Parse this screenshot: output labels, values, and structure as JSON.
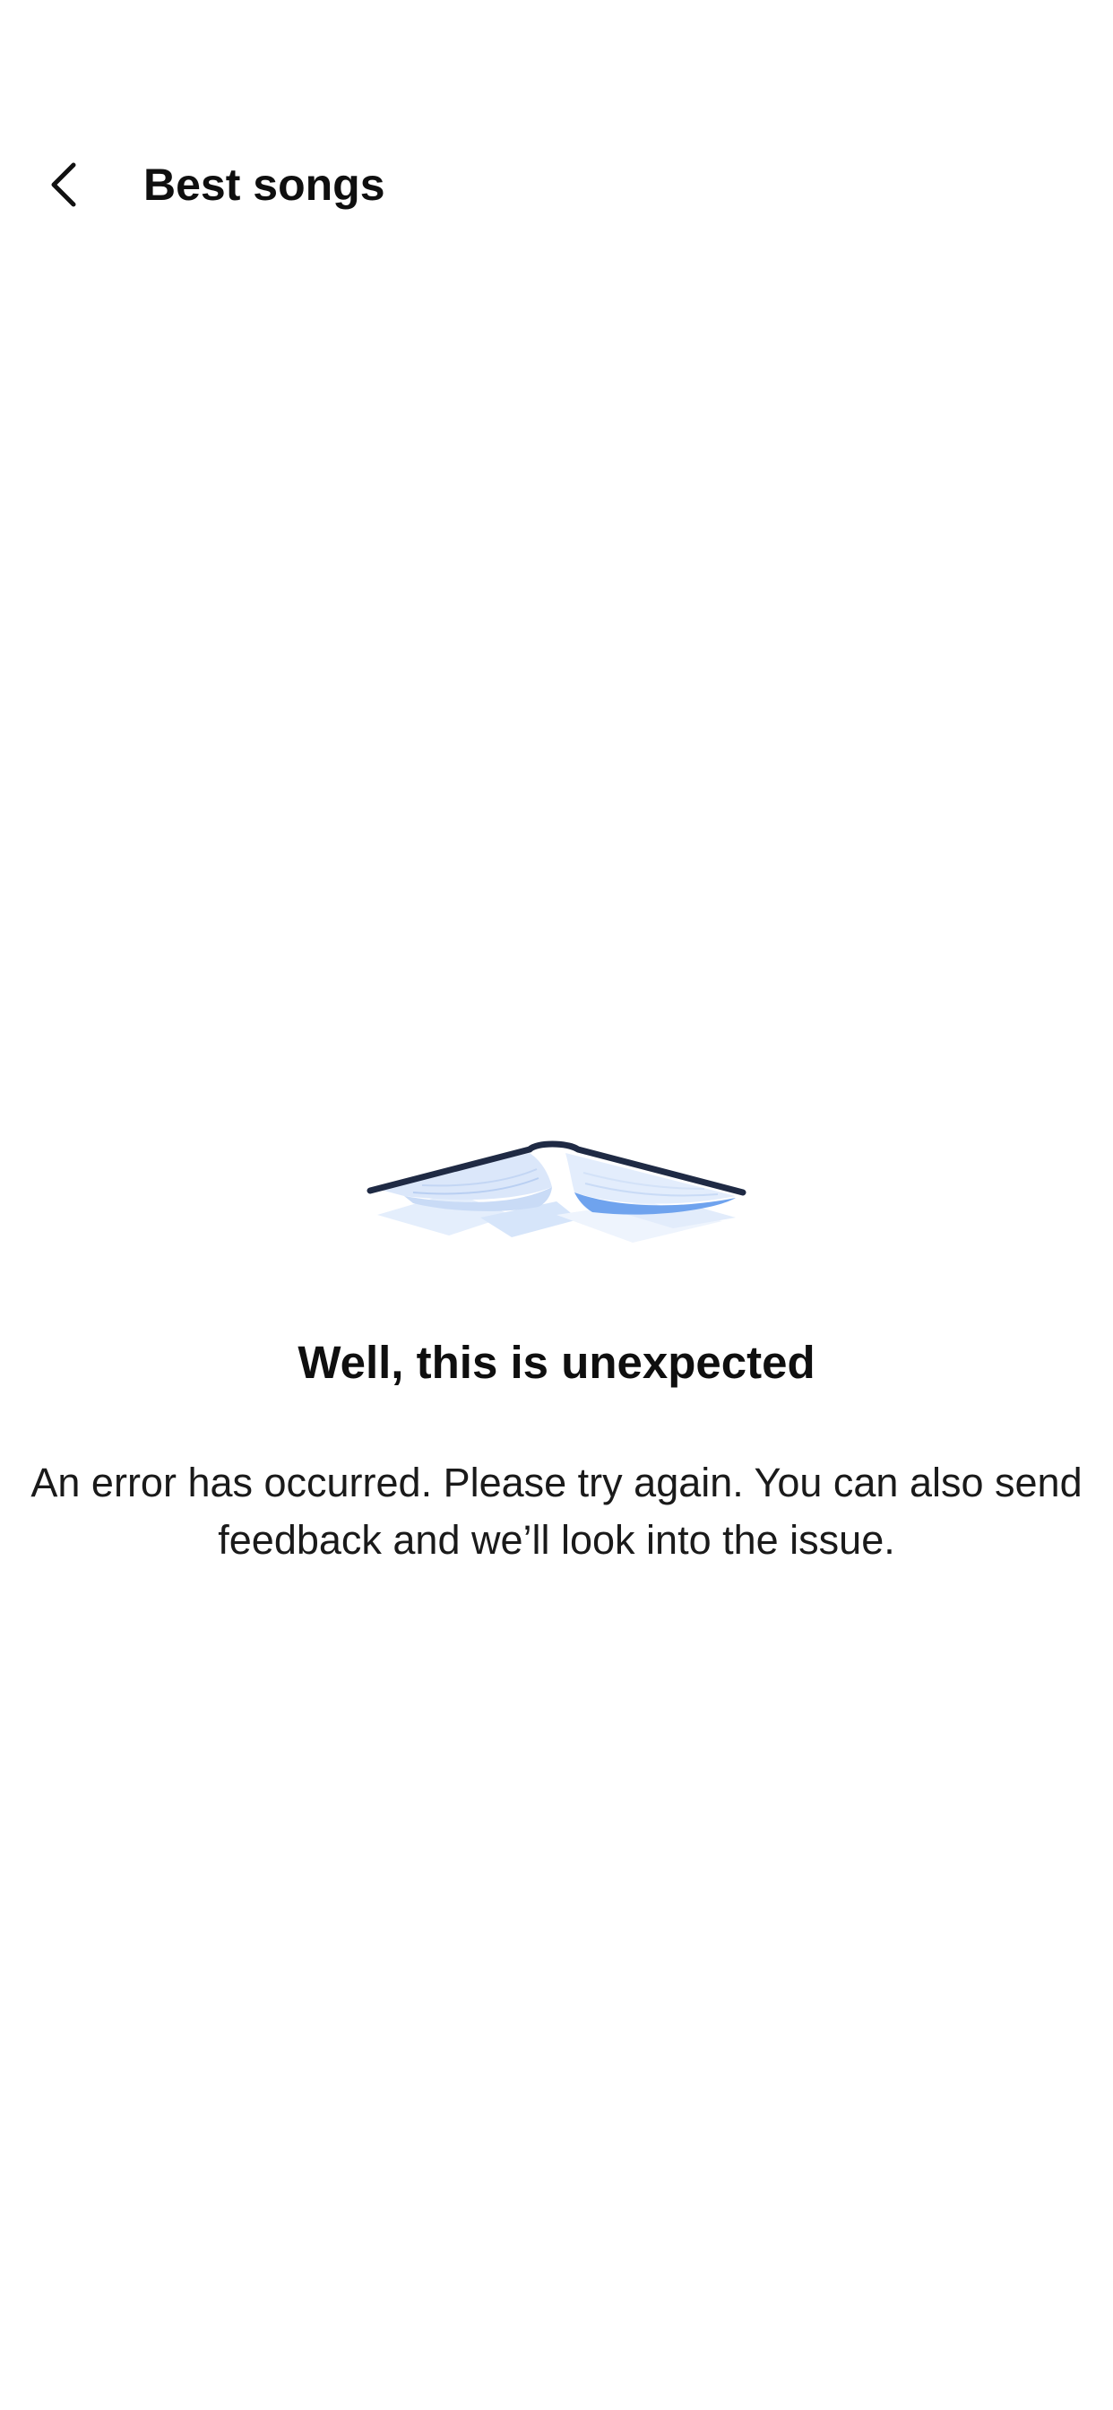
{
  "header": {
    "back_icon": "chevron-left-icon",
    "title": "Best songs"
  },
  "error": {
    "illustration_icon": "open-book-illustration",
    "title": "Well, this is unexpected",
    "message": "An error has occurred. Please try again. You can also send feedback and we’ll look into the issue."
  },
  "colors": {
    "background": "#ffffff",
    "text": "#0f0f0f",
    "book_outline": "#1f2a44",
    "book_page_light": "#dde9fb",
    "book_page_accent": "#6fa3ee"
  }
}
